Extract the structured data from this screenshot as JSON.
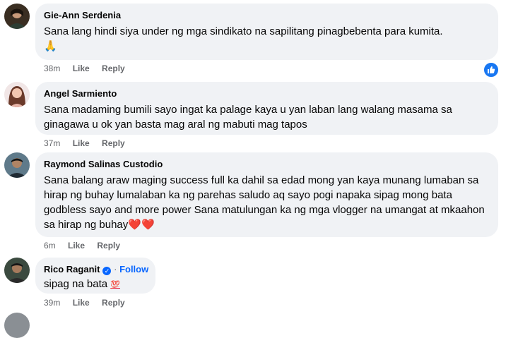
{
  "comments": [
    {
      "author": "Gie-Ann Serdenia",
      "text": "Sana lang hindi siya under ng mga sindikato na sapilitang pinagbebenta para kumita.",
      "emoji": "🙏",
      "time": "38m",
      "like": "Like",
      "reply": "Reply"
    },
    {
      "author": "Angel Sarmiento",
      "text": "Sana madaming bumili sayo ingat ka palage kaya u yan laban lang walang masama sa ginagawa u ok yan basta mag aral ng mabuti mag tapos",
      "time": "37m",
      "like": "Like",
      "reply": "Reply"
    },
    {
      "author": "Raymond Salinas Custodio",
      "text": "Sana balang araw maging success full ka dahil sa edad mong yan kaya munang lumaban sa hirap ng buhay lumalaban ka ng parehas saludo aq sayo pogi napaka sipag mong bata godbless sayo and more power Sana matulungan ka ng mga vlogger na umangat at mkaahon sa hirap ng buhay",
      "emoji": "❤️❤️",
      "time": "6m",
      "like": "Like",
      "reply": "Reply"
    },
    {
      "author": "Rico Raganit",
      "follow": "Follow",
      "separator": "·",
      "text": "sipag na bata",
      "emoji": "💯",
      "time": "39m",
      "like": "Like",
      "reply": "Reply"
    }
  ],
  "colors": {
    "bubble": "#f0f2f5",
    "meta": "#65676b",
    "link": "#0866ff",
    "like_badge": "#1877f2"
  }
}
